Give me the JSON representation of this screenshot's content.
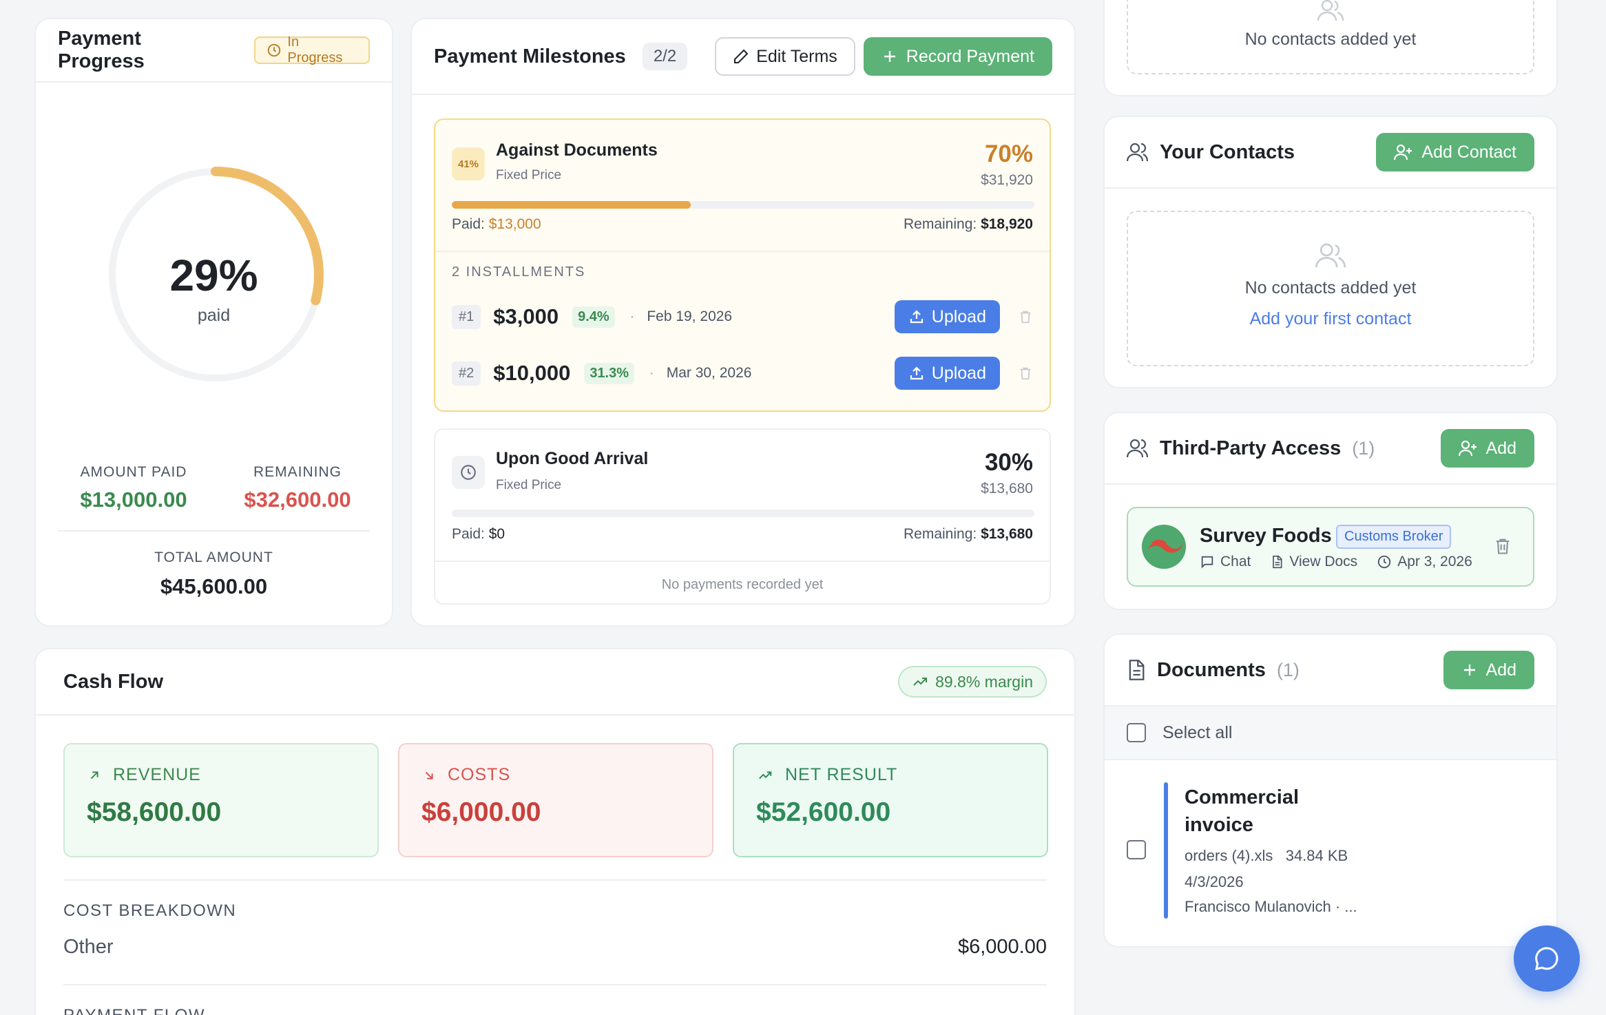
{
  "payment_progress": {
    "title": "Payment Progress",
    "status": "In Progress",
    "percent_paid": 0.29,
    "percent_label": "29%",
    "percent_caption": "paid",
    "amount_paid_label": "AMOUNT PAID",
    "amount_paid": "$13,000.00",
    "remaining_label": "REMAINING",
    "remaining": "$32,600.00",
    "total_label": "TOTAL AMOUNT",
    "total": "$45,600.00"
  },
  "milestones": {
    "title": "Payment Milestones",
    "count": "2/2",
    "edit_label": "Edit Terms",
    "record_label": "Record Payment",
    "items": [
      {
        "badge": "41%",
        "name": "Against Documents",
        "type": "Fixed Price",
        "percent": "70%",
        "amount": "$31,920",
        "progress": 0.41,
        "paid_label": "Paid:",
        "paid": "$13,000",
        "remaining_label": "Remaining:",
        "remaining": "$18,920",
        "installments_label": "2 INSTALLMENTS",
        "installments": [
          {
            "num": "#1",
            "amount": "$3,000",
            "pct": "9.4%",
            "date": "Feb 19, 2026",
            "upload": "Upload"
          },
          {
            "num": "#2",
            "amount": "$10,000",
            "pct": "31.3%",
            "date": "Mar 30, 2026",
            "upload": "Upload"
          }
        ]
      },
      {
        "name": "Upon Good Arrival",
        "type": "Fixed Price",
        "percent": "30%",
        "amount": "$13,680",
        "progress": 0,
        "paid_label": "Paid:",
        "paid": "$0",
        "remaining_label": "Remaining:",
        "remaining": "$13,680",
        "empty": "No payments recorded yet"
      }
    ]
  },
  "cash_flow": {
    "title": "Cash Flow",
    "margin": "89.8% margin",
    "revenue_label": "REVENUE",
    "revenue": "$58,600.00",
    "costs_label": "COSTS",
    "costs": "$6,000.00",
    "net_label": "NET RESULT",
    "net": "$52,600.00",
    "breakdown_label": "COST BREAKDOWN",
    "breakdown_item": "Other",
    "breakdown_value": "$6,000.00",
    "payment_flow_label": "PAYMENT FLOW"
  },
  "top_contacts": {
    "empty": "No contacts added yet"
  },
  "your_contacts": {
    "title": "Your Contacts",
    "add_label": "Add Contact",
    "empty": "No contacts added yet",
    "link": "Add your first contact"
  },
  "third_party": {
    "title": "Third-Party Access",
    "count": "(1)",
    "add_label": "Add",
    "item": {
      "name": "Survey Foods",
      "role": "Customs Broker",
      "chat": "Chat",
      "docs": "View Docs",
      "date": "Apr 3, 2026"
    }
  },
  "documents": {
    "title": "Documents",
    "count": "(1)",
    "add_label": "Add",
    "select_all": "Select all",
    "item": {
      "title": "Commercial invoice",
      "file": "orders (4).xls",
      "size": "34.84 KB",
      "date": "4/3/2026",
      "author": "Francisco Mulanovich · ..."
    }
  },
  "colors": {
    "green": "#5cb277",
    "blue": "#4a7ee6",
    "amber": "#e7a84a",
    "red": "#d9534f"
  }
}
